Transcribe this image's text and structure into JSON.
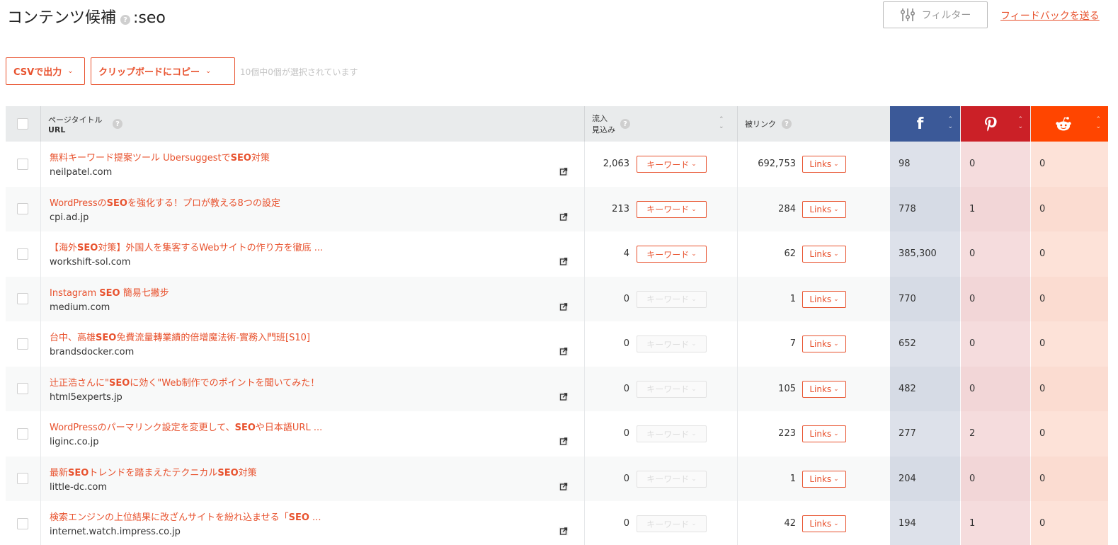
{
  "header": {
    "title": "コンテンツ候補",
    "colon": ":",
    "keyword": "seo",
    "filter_label": "フィルター",
    "feedback_label": "フィードバックを送る"
  },
  "toolbar": {
    "csv_label": "CSVで出力",
    "clipboard_label": "クリップボードにコピー",
    "selection_count": "10個中0個が選択されています"
  },
  "table": {
    "columns": {
      "page_title": "ページタイトル",
      "url": "URL",
      "traffic_line1": "流入",
      "traffic_line2": "見込み",
      "backlinks": "被リンク"
    },
    "keyword_button_label": "キーワード",
    "links_button_label": "Links",
    "rows": [
      {
        "title_html": "無料キーワード提案ツール Ubersuggestで<b>SEO</b>対策",
        "url": "neilpatel.com",
        "traffic": "2,063",
        "keyword_enabled": true,
        "backlinks": "692,753",
        "facebook": "98",
        "pinterest": "0",
        "reddit": "0"
      },
      {
        "title_html": "WordPressの<b>SEO</b>を強化する！プロが教える8つの設定",
        "url": "cpi.ad.jp",
        "traffic": "213",
        "keyword_enabled": true,
        "backlinks": "284",
        "facebook": "778",
        "pinterest": "1",
        "reddit": "0"
      },
      {
        "title_html": "【海外<b>SEO</b>対策】外国人を集客するWebサイトの作り方を徹底 ...",
        "url": "workshift-sol.com",
        "traffic": "4",
        "keyword_enabled": true,
        "backlinks": "62",
        "facebook": "385,300",
        "pinterest": "0",
        "reddit": "0"
      },
      {
        "title_html": "Instagram <b>SEO</b> 簡易七撇步",
        "url": "medium.com",
        "traffic": "0",
        "keyword_enabled": false,
        "backlinks": "1",
        "facebook": "770",
        "pinterest": "0",
        "reddit": "0"
      },
      {
        "title_html": "台中、高雄<b>SEO</b>免費流量轉業績的倍增魔法術-實務入門班[S10]",
        "url": "brandsdocker.com",
        "traffic": "0",
        "keyword_enabled": false,
        "backlinks": "7",
        "facebook": "652",
        "pinterest": "0",
        "reddit": "0"
      },
      {
        "title_html": "辻正浩さんに\"<b>SEO</b>に効く\"Web制作でのポイントを聞いてみた！",
        "url": "html5experts.jp",
        "traffic": "0",
        "keyword_enabled": false,
        "backlinks": "105",
        "facebook": "482",
        "pinterest": "0",
        "reddit": "0"
      },
      {
        "title_html": "WordPressのパーマリンク設定を変更して、<b>SEO</b>や日本語URL ...",
        "url": "liginc.co.jp",
        "traffic": "0",
        "keyword_enabled": false,
        "backlinks": "223",
        "facebook": "277",
        "pinterest": "2",
        "reddit": "0"
      },
      {
        "title_html": "最新<b>SEO</b>トレンドを踏まえたテクニカル<b>SEO</b>対策",
        "url": "little-dc.com",
        "traffic": "0",
        "keyword_enabled": false,
        "backlinks": "1",
        "facebook": "204",
        "pinterest": "0",
        "reddit": "0"
      },
      {
        "title_html": "検索エンジンの上位結果に改ざんサイトを紛れ込ませる「<b>SEO</b> ...",
        "url": "internet.watch.impress.co.jp",
        "traffic": "0",
        "keyword_enabled": false,
        "backlinks": "42",
        "facebook": "194",
        "pinterest": "1",
        "reddit": "0"
      }
    ]
  },
  "colors": {
    "accent": "#e8522e",
    "facebook": "#3b5998",
    "pinterest": "#cb2027",
    "reddit": "#ff4500"
  },
  "icons": {
    "help": "question-circle-icon",
    "filter": "sliders-icon",
    "external": "external-link-icon",
    "facebook": "facebook-icon",
    "pinterest": "pinterest-icon",
    "reddit": "reddit-icon"
  }
}
